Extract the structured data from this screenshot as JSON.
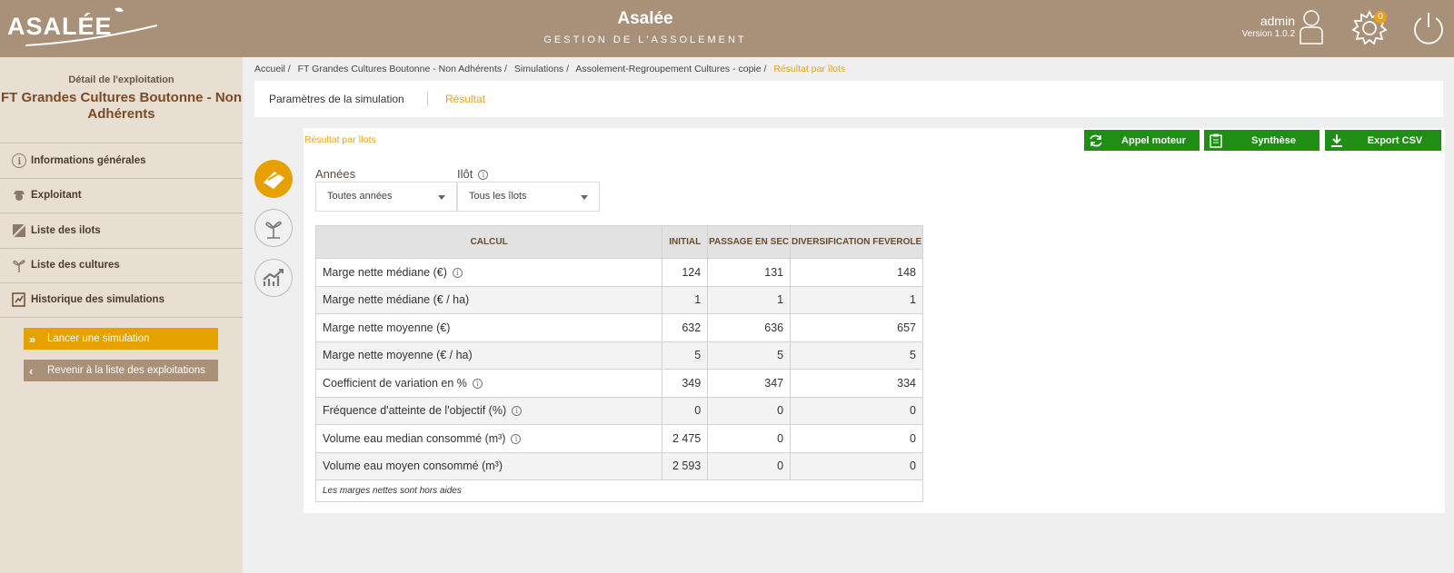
{
  "header": {
    "logo_text": "ASALÉE",
    "title": "Asalée",
    "subtitle": "GESTION DE L'ASSOLEMENT",
    "user_name": "admin",
    "version": "Version 1.0.2",
    "notification_count": "0"
  },
  "sidebar": {
    "caption": "Détail de l'exploitation",
    "title": "FT Grandes Cultures Boutonne - Non Adhérents",
    "items": [
      {
        "label": "Informations générales",
        "icon": "info-icon"
      },
      {
        "label": "Exploitant",
        "icon": "farmer-icon"
      },
      {
        "label": "Liste des ilots",
        "icon": "parcel-icon"
      },
      {
        "label": "Liste des cultures",
        "icon": "plant-icon"
      },
      {
        "label": "Historique des simulations",
        "icon": "history-icon"
      }
    ],
    "launch_button": "Lancer une simulation",
    "back_button": "Revenir à la liste des exploitations"
  },
  "breadcrumb": [
    "Accueil /",
    "FT Grandes Cultures Boutonne - Non Adhérents /",
    "Simulations /",
    "Assolement-Regroupement Cultures - copie /",
    "Résultat par îlots"
  ],
  "tabs": {
    "params": "Paramètres de la simulation",
    "result": "Résultat"
  },
  "subtab": "Résultat par îlots",
  "actions": {
    "appel": "Appel moteur",
    "synthese": "Synthèse",
    "export": "Export CSV"
  },
  "filters": {
    "years_label": "Années",
    "years_value": "Toutes années",
    "ilot_label": "Ilôt",
    "ilot_value": "Tous les îlots"
  },
  "table": {
    "headers": [
      "CALCUL",
      "INITIAL",
      "PASSAGE EN SEC",
      "DIVERSIFICATION FEVEROLE"
    ],
    "rows": [
      {
        "name": "Marge nette médiane (€)",
        "info": true,
        "values": [
          "124",
          "131",
          "148"
        ]
      },
      {
        "name": "Marge nette médiane (€ / ha)",
        "info": false,
        "values": [
          "1",
          "1",
          "1"
        ]
      },
      {
        "name": "Marge nette moyenne (€)",
        "info": false,
        "values": [
          "632",
          "636",
          "657"
        ]
      },
      {
        "name": "Marge nette moyenne (€ / ha)",
        "info": false,
        "values": [
          "5",
          "5",
          "5"
        ]
      },
      {
        "name": "Coefficient de variation en %",
        "info": true,
        "values": [
          "349",
          "347",
          "334"
        ]
      },
      {
        "name": "Fréquence d'atteinte de l'objectif (%)",
        "info": true,
        "values": [
          "0",
          "0",
          "0"
        ]
      },
      {
        "name": "Volume eau median consommé (m³)",
        "info": true,
        "values": [
          "2 475",
          "0",
          "0"
        ]
      },
      {
        "name": "Volume eau moyen consommé (m³)",
        "info": false,
        "values": [
          "2 593",
          "0",
          "0"
        ]
      }
    ],
    "footnote": "Les marges nettes sont hors aides"
  },
  "colors": {
    "header_bg": "#a89079",
    "accent": "#e6a000",
    "green": "#1e8e15"
  }
}
